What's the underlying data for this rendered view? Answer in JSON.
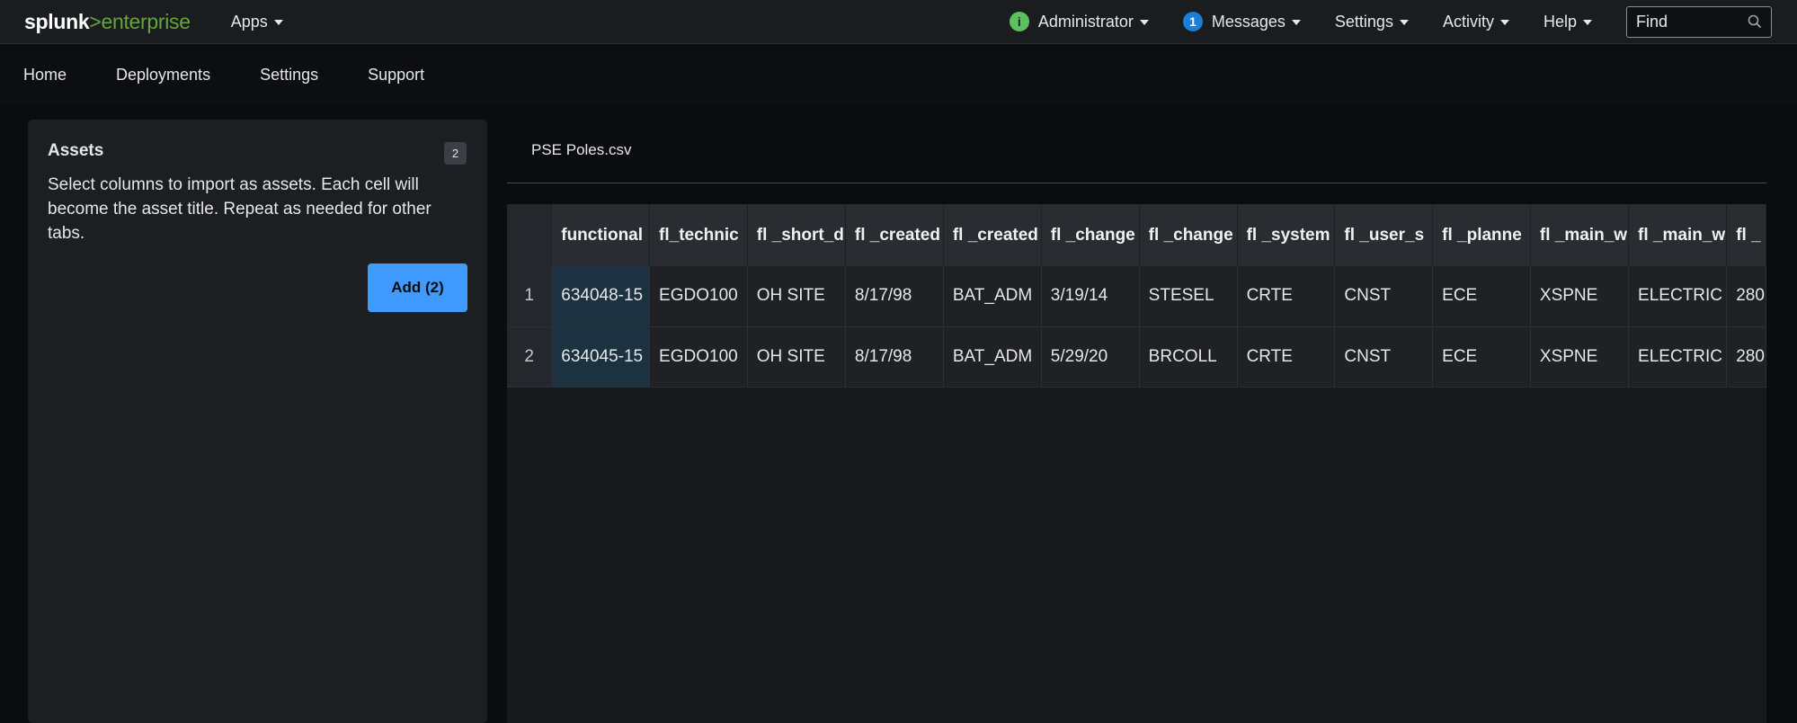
{
  "topbar": {
    "logo": {
      "prefix": "splunk",
      "arrow": ">",
      "suffix": "enterprise"
    },
    "apps": "Apps",
    "admin": "Administrator",
    "admin_icon": "i",
    "messages_count": "1",
    "messages": "Messages",
    "settings": "Settings",
    "activity": "Activity",
    "help": "Help",
    "find_placeholder": "Find"
  },
  "nav": {
    "items": [
      "Home",
      "Deployments",
      "Settings",
      "Support"
    ]
  },
  "panel": {
    "title": "Assets",
    "badge": "2",
    "description": "Select columns to import as assets. Each cell will become the asset title. Repeat as needed for other tabs.",
    "add_button": "Add (2)"
  },
  "file_tab": "PSE Poles.csv",
  "table": {
    "columns": [
      "functional",
      "fl_technic",
      "fl _short_d",
      "fl _created",
      "fl _created",
      "fl _change",
      "fl _change",
      "fl _system",
      "fl _user_s",
      "fl _planne",
      "fl _main_w",
      "fl _main_w",
      "fl _"
    ],
    "rows": [
      {
        "index": "1",
        "cells": [
          "634048-15",
          "EGDO100",
          "OH SITE",
          "8/17/98",
          "BAT_ADM",
          "3/19/14",
          "STESEL",
          "CRTE",
          "CNST",
          "ECE",
          "XSPNE",
          "ELECTRIC",
          "280"
        ]
      },
      {
        "index": "2",
        "cells": [
          "634045-15",
          "EGDO100",
          "OH SITE",
          "8/17/98",
          "BAT_ADM",
          "5/29/20",
          "BRCOLL",
          "CRTE",
          "CNST",
          "ECE",
          "XSPNE",
          "ELECTRIC",
          "280"
        ]
      }
    ]
  },
  "colors": {
    "accent": "#3f9bff",
    "brand_green": "#65a637",
    "selected_column": "#1d3240"
  }
}
